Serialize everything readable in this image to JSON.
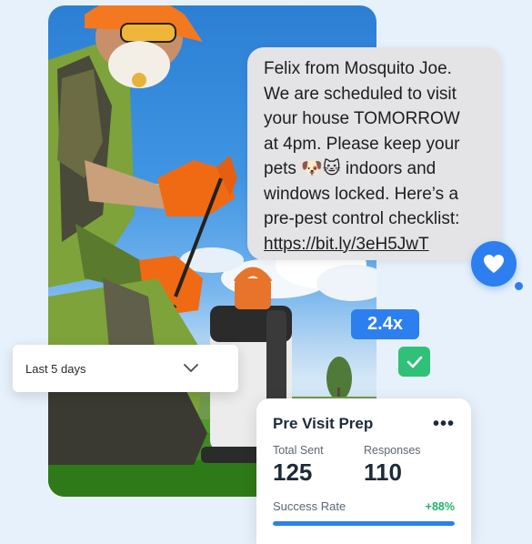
{
  "sms": {
    "message": "Felix from Mosquito Joe.\nWe are scheduled to visit\nyour house TOMORROW\nat 4pm. Please keep your\npets 🐶🐱 indoors and\nwindows locked. Here’s a\npre-pest control checklist:",
    "link": "https://bit.ly/3eH5JwT"
  },
  "badges": {
    "multiplier": "2.4x"
  },
  "dropdown": {
    "selected": "Last 5 days"
  },
  "card": {
    "title": "Pre Visit Prep",
    "total_sent_label": "Total Sent",
    "total_sent_value": "125",
    "responses_label": "Responses",
    "responses_value": "110",
    "success_label": "Success Rate",
    "success_value": "+88%",
    "success_fill": 1.0
  },
  "icons": {
    "heart": "heart-icon",
    "check": "check-icon",
    "chevron": "chevron-down-icon",
    "menu": "more-horizontal-icon"
  },
  "colors": {
    "accent_blue": "#2d7ff0",
    "success_green": "#22b36b",
    "check_green": "#2fc178",
    "bubble_gray": "#e4e4e7",
    "page_bg": "#e7f1fb"
  }
}
